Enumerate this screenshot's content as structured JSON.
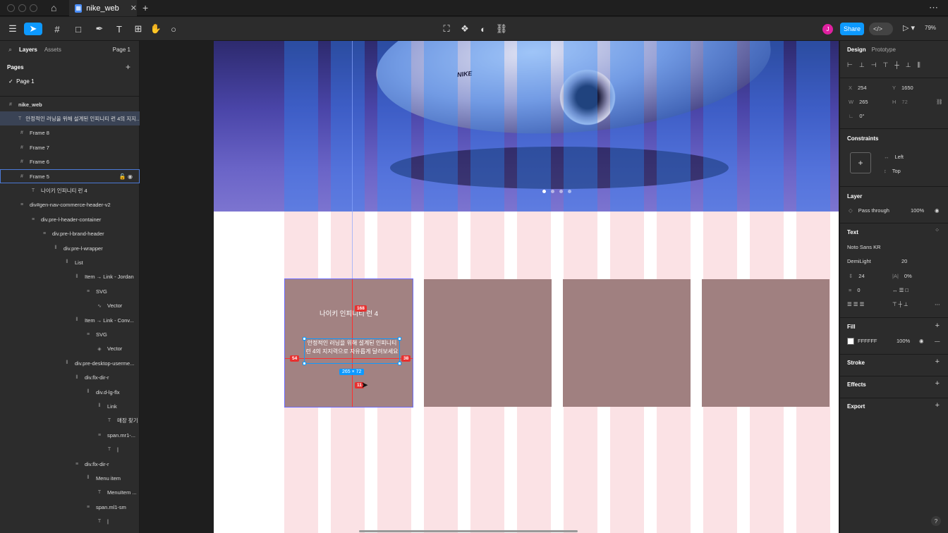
{
  "titlebar": {
    "tab_title": "nike_web",
    "tab_close": "✕",
    "new_tab": "+",
    "more": "⋯"
  },
  "toolbar": {
    "avatar_initial": "J",
    "share_label": "Share",
    "devmode_label": "</>",
    "zoom_label": "79%"
  },
  "left_panel": {
    "tabs": [
      "Layers",
      "Assets"
    ],
    "page_selector": "Page 1",
    "pages_heading": "Pages",
    "pages": [
      "Page 1"
    ],
    "layers": [
      {
        "label": "nike_web",
        "icon": "#"
      },
      {
        "label": "안정적인 러닝을 위해 설계된 인피니티 런 4의 지지...",
        "icon": "T"
      },
      {
        "label": "Frame 8",
        "icon": "#"
      },
      {
        "label": "Frame 7",
        "icon": "#"
      },
      {
        "label": "Frame 6",
        "icon": "#"
      },
      {
        "label": "Frame 5",
        "icon": "#"
      },
      {
        "label": "나이키 인피니티 런 4",
        "icon": "T"
      },
      {
        "label": "div#gen-nav-commerce-header-v2",
        "icon": "≡"
      },
      {
        "label": "div.pre-l-header-container",
        "icon": "≡"
      },
      {
        "label": "div.pre-l-brand-header",
        "icon": "≡"
      },
      {
        "label": "div.pre-l-wrapper",
        "icon": "⫴"
      },
      {
        "label": "List",
        "icon": "⫴"
      },
      {
        "label": "Item → Link - Jordan",
        "icon": "⫴"
      },
      {
        "label": "SVG",
        "icon": "≡"
      },
      {
        "label": "Vector",
        "icon": "∿"
      },
      {
        "label": "Item → Link - Conv...",
        "icon": "⫴"
      },
      {
        "label": "SVG",
        "icon": "≡"
      },
      {
        "label": "Vector",
        "icon": "◈"
      },
      {
        "label": "div.pre-desktop-userme...",
        "icon": "⫴"
      },
      {
        "label": "div.flx-dir-r",
        "icon": "⫴"
      },
      {
        "label": "div.d-lg-flx",
        "icon": "⫴"
      },
      {
        "label": "Link",
        "icon": "⫴"
      },
      {
        "label": "매장 찾기",
        "icon": "T"
      },
      {
        "label": "span.mr1-...",
        "icon": "≡"
      },
      {
        "label": "|",
        "icon": "T"
      },
      {
        "label": "div.flx-dir-r",
        "icon": "≡"
      },
      {
        "label": "Menu item",
        "icon": "⫴"
      },
      {
        "label": "MenuItem ...",
        "icon": "T"
      },
      {
        "label": "span.ml1-sm",
        "icon": "≡"
      },
      {
        "label": "|",
        "icon": "T"
      }
    ]
  },
  "canvas": {
    "shoe_logo": "NIKE",
    "card_title": "나이키 인피니티 런 4",
    "card_desc": "안정적인 러닝을 위해 설계된 인피니티 런 4의 지지력으로 자유롭게 달려보세요",
    "measure_top": "168",
    "measure_left": "54",
    "measure_right": "38",
    "measure_bottom": "11",
    "size_label": "265 × 72",
    "carousel_active_index": 0,
    "carousel_count": 4
  },
  "right_panel": {
    "tabs": [
      "Design",
      "Prototype"
    ],
    "x": "254",
    "y": "1650",
    "w": "265",
    "h": "72",
    "rotation": "0°",
    "constraints_heading": "Constraints",
    "constraint_h": "Left",
    "constraint_v": "Top",
    "layer_heading": "Layer",
    "blend": "Pass through",
    "opacity": "100%",
    "text_heading": "Text",
    "font_family": "Noto Sans KR",
    "font_weight": "DemiLight",
    "font_size": "20",
    "line_height": "24",
    "letter_spacing": "0%",
    "paragraph_spacing": "0",
    "fill_heading": "Fill",
    "fill_hex": "FFFFFF",
    "fill_opacity": "100%",
    "stroke_heading": "Stroke",
    "effects_heading": "Effects",
    "export_heading": "Export",
    "help": "?"
  }
}
